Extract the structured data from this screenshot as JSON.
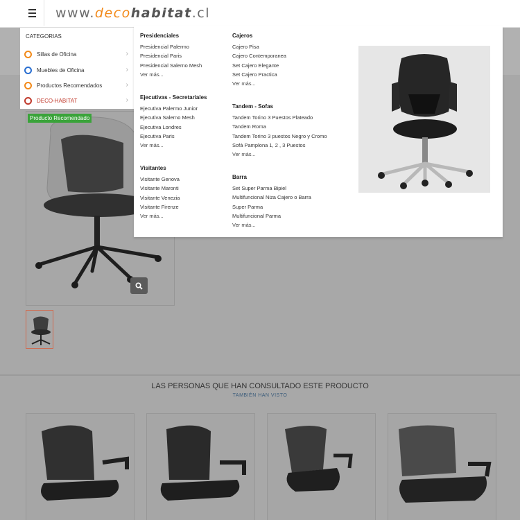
{
  "header": {
    "logo_www": "www.",
    "logo_deco": "deco",
    "logo_habitat": "habitat",
    "logo_tld": ".cl"
  },
  "categories": {
    "title": "CATEGORIAS",
    "items": [
      {
        "label": "Sillas de Oficina",
        "color": "#f28a1a"
      },
      {
        "label": "Muebles de Oficina",
        "color": "#2a6fd1"
      },
      {
        "label": "Productos Recomendados",
        "color": "#f28a1a"
      },
      {
        "label": "DECO-HABITAT",
        "color": "#c0392b"
      }
    ]
  },
  "menu": {
    "col1": [
      {
        "title": "Presidenciales",
        "links": [
          "Presidencial Palermo",
          "Presidencial Paris",
          "Presidencial Salerno Mesh",
          "Ver más..."
        ]
      },
      {
        "title": "Ejecutivas - Secretariales",
        "links": [
          "Ejecutiva Palermo Junior",
          "Ejecutiva Salerno Mesh",
          "Ejecutiva Londres",
          "Ejecutiva Paris",
          "Ver más..."
        ]
      },
      {
        "title": "Visitantes",
        "links": [
          "Visitante Genova",
          "Visitante Maronti",
          "Visitante Venezia",
          "Visitante Firenze",
          "Ver más..."
        ]
      }
    ],
    "col2": [
      {
        "title": "Cajeros",
        "links": [
          "Cajero Pisa",
          "Cajero Contemporanea",
          "Set Cajero Elegante",
          "Set Cajero Practica",
          "Ver más..."
        ]
      },
      {
        "title": "Tandem - Sofas",
        "links": [
          "Tandem Torino 3 Puestos Plateado",
          "Tandem Roma",
          "Tandem Torino 3 puestos Negro y Cromo",
          "Sofá Pamplona 1, 2 , 3 Puestos",
          "Ver más..."
        ]
      },
      {
        "title": "Barra",
        "links": [
          "Set Super Parma Bipiel",
          "Multifuncional Niza Cajero o Barra",
          "Super Parma",
          "Multifuncional Parma",
          "Ver más..."
        ]
      }
    ]
  },
  "product": {
    "badge": "Producto Recomendado"
  },
  "related": {
    "title": "LAS PERSONAS QUE HAN CONSULTADO ESTE PRODUCTO",
    "subtitle": "TAMBIÉN HAN VISTO"
  },
  "icons": {
    "menu": "hamburger-icon",
    "zoom": "magnifier-icon",
    "chevron": "chevron-right-icon"
  }
}
